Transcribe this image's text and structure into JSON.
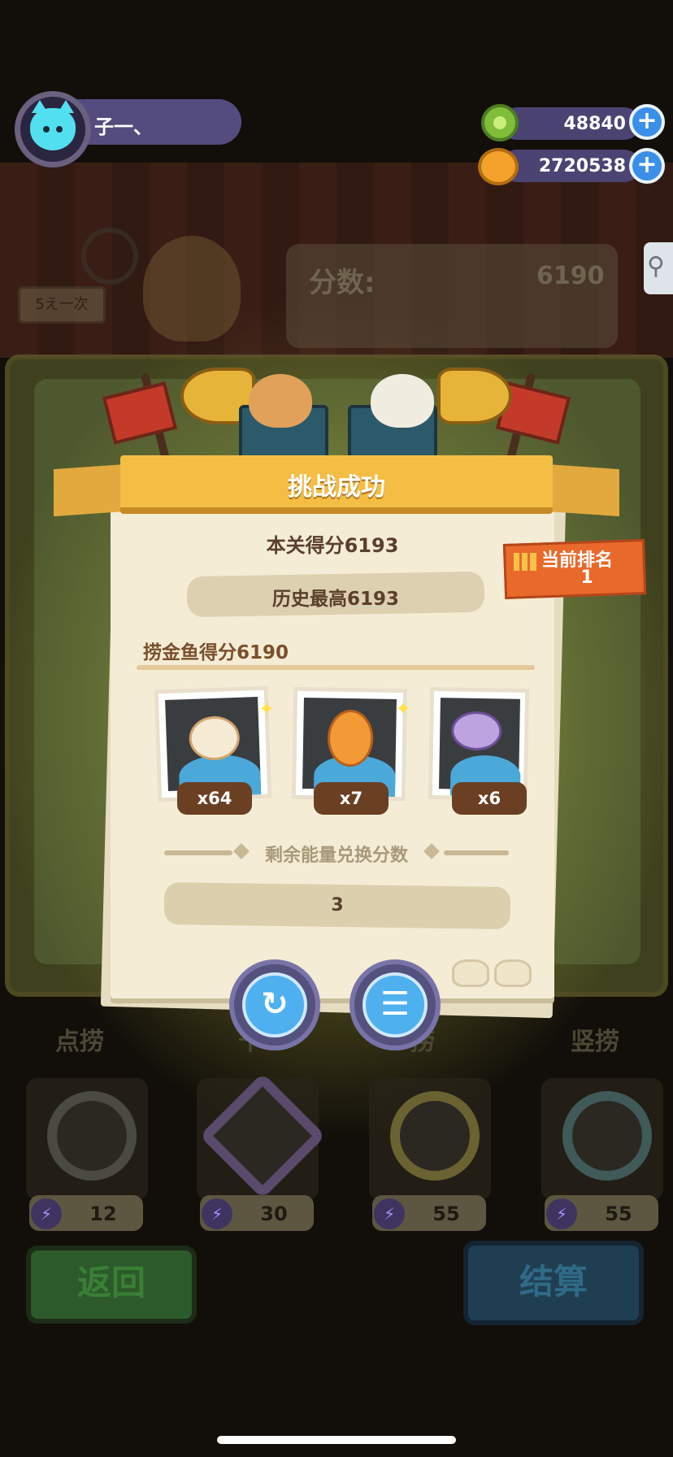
{
  "player": {
    "name": "子一、",
    "avatar_icon": "cat-avatar-icon"
  },
  "currencies": [
    {
      "name": "green-coin",
      "value": "48840",
      "color": "#7fbd3a"
    },
    {
      "name": "gold-coin",
      "value": "2720538",
      "color": "#f5a22a"
    }
  ],
  "background": {
    "sign_text": "5え一次",
    "score_label": "分数:",
    "score_value": "6190",
    "tools": [
      {
        "label": "点捞",
        "cost": "12"
      },
      {
        "label": "十",
        "cost": "30"
      },
      {
        "label": "捞",
        "cost": "55"
      },
      {
        "label": "竖捞",
        "cost": "55"
      }
    ],
    "back_button": "返回",
    "settle_button": "结算"
  },
  "dialog": {
    "title": "挑战成功",
    "stage_score": "本关得分6193",
    "best_score": "历史最高6193",
    "rank_label": "当前排名",
    "rank_value": "1",
    "fish_score": "捞金鱼得分6190",
    "fish_catches": [
      {
        "icon": "white-goldfish-icon",
        "count": "x64"
      },
      {
        "icon": "orange-goldfish-icon",
        "count": "x7"
      },
      {
        "icon": "helmet-fish-icon",
        "count": "x6"
      }
    ],
    "energy_label": "剩余能量兑换分数",
    "energy_value": "3",
    "replay_icon": "replay-icon",
    "list_icon": "list-icon"
  },
  "colors": {
    "accent": "#f4be45",
    "paper": "#f4ecd5",
    "rank_tag": "#e9692b",
    "button_blue": "#4fb0f0"
  }
}
